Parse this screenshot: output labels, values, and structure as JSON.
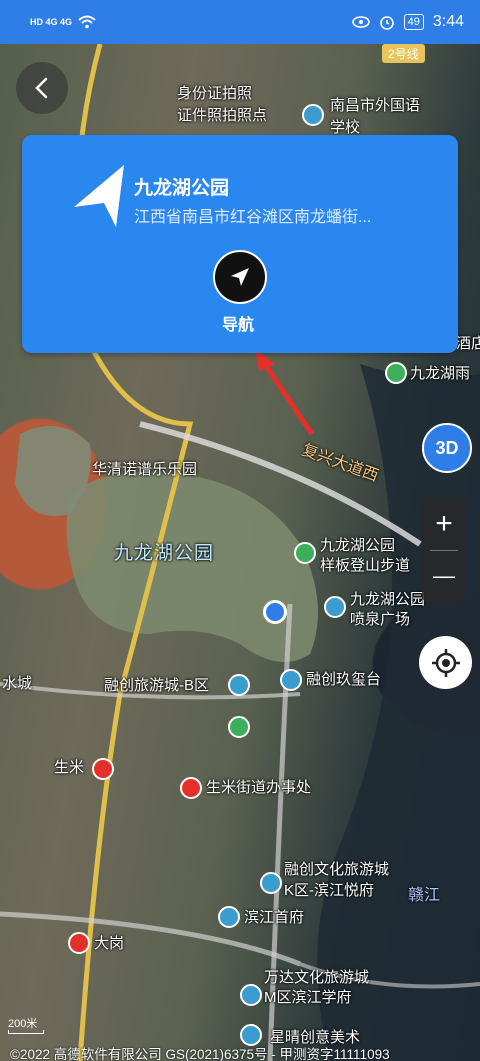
{
  "status_bar": {
    "signal_left": "HD 4G 4G",
    "battery": "49",
    "time": "3:44"
  },
  "back": {
    "icon": "back-chevron-icon"
  },
  "card": {
    "title": "九龙湖公园",
    "address": "江西省南昌市红谷滩区南龙蟠街...",
    "nav_label": "导航"
  },
  "controls": {
    "three_d": "3D",
    "zoom_in": "+",
    "zoom_out": "—"
  },
  "map": {
    "metro_badge": "2号线",
    "labels": {
      "id_photo": "身份证拍照",
      "id_photo2": "证件照拍照点",
      "school": "南昌市外国语",
      "school2": "学校",
      "huaqing": "华清诺谱乐乐园",
      "park_big": "九龙湖公园",
      "park_trail": "九龙湖公园",
      "park_trail2": "样板登山步道",
      "fountain": "九龙湖公园",
      "fountain2": "喷泉广场",
      "road": "复兴大道西",
      "rongchuang_b": "融创旅游城-B区",
      "rongchuang_jiuxi": "融创玖玺台",
      "shengmi": "生米",
      "shengmi_office": "生米街道办事处",
      "rongchuang_k": "融创文化旅游城",
      "rongchuang_k2": "K区-滨江悦府",
      "binjiang": "滨江首府",
      "ganjiang": "赣江",
      "dagang": "大岗",
      "wanda": "万达文化旅游城",
      "wanda2": "M区滨江学府",
      "xingqing": "星晴创意美术",
      "hotel": "酒店",
      "jiulong_rain": "九龙湖雨",
      "shui": "水城",
      "binjiang_left": "滨"
    },
    "scale": "200米",
    "copyright": "©2022 高德软件有限公司 GS(2021)6375号 - 甲测资字11111093"
  },
  "colors": {
    "accent": "#2b87f0",
    "statusbar": "#2f7de6"
  }
}
